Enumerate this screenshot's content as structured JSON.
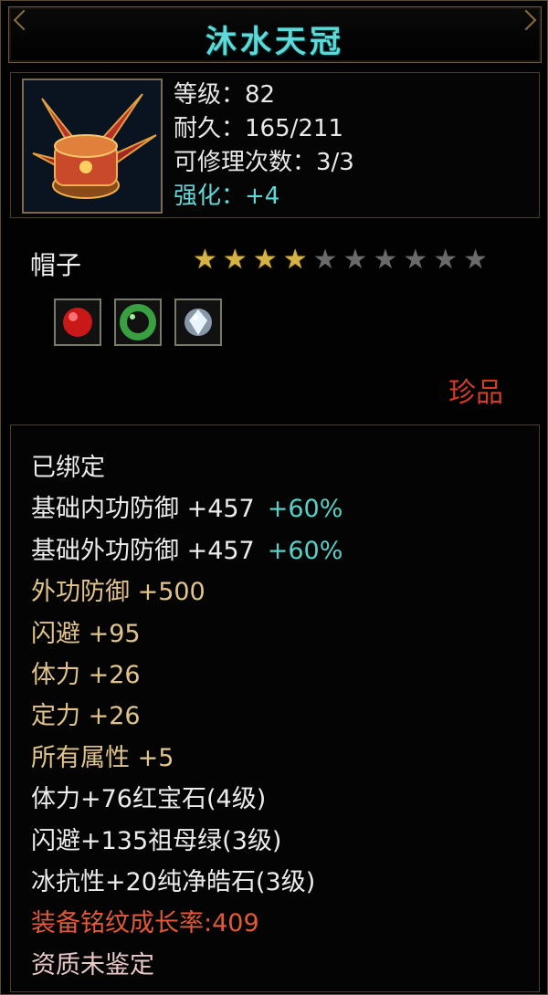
{
  "item": {
    "name": "沐水天冠",
    "type": "帽子",
    "rarity": "珍品",
    "stars_total": 10,
    "stars_filled": 4
  },
  "stats": {
    "level": "等级：82",
    "durability": "耐久：165/211",
    "repairs": "可修理次数：3/3",
    "enhance": "强化：+4"
  },
  "gems": [
    {
      "icon": "ruby-gem-icon",
      "color": "#d02020"
    },
    {
      "icon": "emerald-gem-icon",
      "color": "#3aa040"
    },
    {
      "icon": "diamond-gem-icon",
      "color": "#d8e8f0"
    }
  ],
  "attributes": {
    "bound": "已绑定",
    "base_inner_def": "基础内功防御 +457",
    "base_inner_def_bonus": "+60%",
    "base_outer_def": "基础外功防御 +457",
    "base_outer_def_bonus": "+60%",
    "outer_def": "外功防御 +500",
    "dodge": "闪避 +95",
    "stamina": "体力 +26",
    "focus": "定力 +26",
    "all_attr": "所有属性 +5",
    "gem_ruby": "体力+76红宝石(4级)",
    "gem_emerald": "闪避+135祖母绿(3级)",
    "gem_diamond": "冰抗性+20纯净皓石(3级)",
    "growth": "装备铭纹成长率:409",
    "aptitude": "资质未鉴定"
  },
  "colors": {
    "title": "#5fd8d8",
    "enhance": "#5fd8d8",
    "gold_attr": "#e1c48c",
    "bonus": "#58d0c8",
    "rarity": "#d23a2a",
    "growth": "#e05a3a"
  }
}
